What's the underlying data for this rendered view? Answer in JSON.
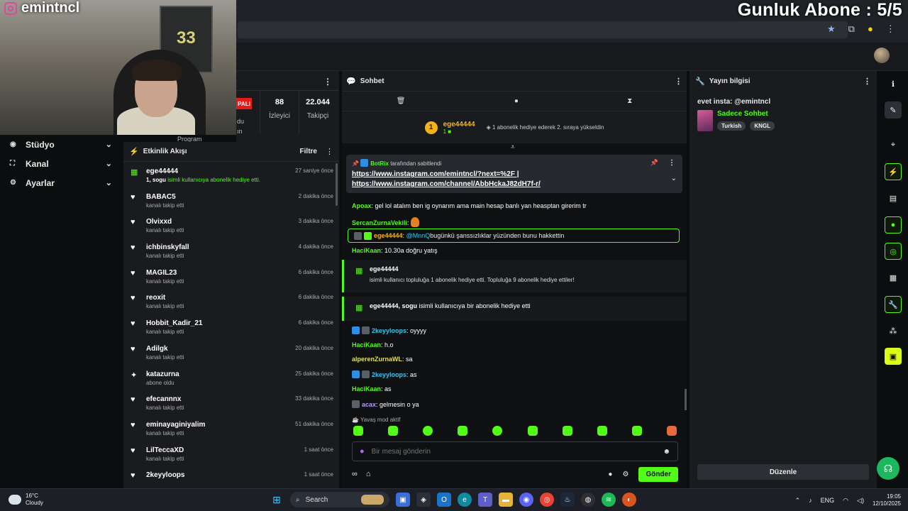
{
  "overlay": {
    "brand": "emintncl",
    "daily_subs": "Gunluk Abone : 5/5"
  },
  "left_nav": {
    "items": [
      {
        "label": "Stüdyo",
        "icon": "studio-icon"
      },
      {
        "label": "Kanal",
        "icon": "channel-icon"
      },
      {
        "label": "Ayarlar",
        "icon": "gear-icon"
      }
    ]
  },
  "stats": {
    "live_badge": "PALI",
    "viewers_value": "88",
    "viewers_label": "İzleyici",
    "followers_value": "22.044",
    "followers_label": "Takipçi",
    "partial_label_a": "du",
    "partial_label_b": "ın",
    "partial_label_c": "Program"
  },
  "feed": {
    "title": "Etkinlik Akışı",
    "filter": "Filtre",
    "items": [
      {
        "name": "ege44444",
        "desc_strong": "1, sogu",
        "desc": " isimli kullanıcıya abonelik hediye etti.",
        "time": "27 saniye önce",
        "icon": "gift-icon"
      },
      {
        "name": "BABAC5",
        "desc": "kanalı takip etti",
        "time": "2 dakika önce",
        "icon": "heart-icon"
      },
      {
        "name": "Olvixxd",
        "desc": "kanalı takip etti",
        "time": "3 dakika önce",
        "icon": "heart-icon"
      },
      {
        "name": "ichbinskyfall",
        "desc": "kanalı takip etti",
        "time": "4 dakika önce",
        "icon": "heart-icon"
      },
      {
        "name": "MAGIL23",
        "desc": "kanalı takip etti",
        "time": "6 dakika önce",
        "icon": "heart-icon"
      },
      {
        "name": "reoxit",
        "desc": "kanalı takip etti",
        "time": "6 dakika önce",
        "icon": "heart-icon"
      },
      {
        "name": "Hobbit_Kadir_21",
        "desc": "kanalı takip etti",
        "time": "6 dakika önce",
        "icon": "heart-icon"
      },
      {
        "name": "Adilgk",
        "desc": "kanalı takip etti",
        "time": "20 dakika önce",
        "icon": "heart-icon"
      },
      {
        "name": "katazurna",
        "desc": "abone oldu",
        "time": "25 dakika önce",
        "icon": "star-icon"
      },
      {
        "name": "efecannnx",
        "desc": "kanalı takip etti",
        "time": "33 dakika önce",
        "icon": "heart-icon"
      },
      {
        "name": "eminayaginiyalim",
        "desc": "kanalı takip etti",
        "time": "51 dakika önce",
        "icon": "heart-icon"
      },
      {
        "name": "LilTeccaXD",
        "desc": "kanalı takip etti",
        "time": "1 saat önce",
        "icon": "heart-icon"
      },
      {
        "name": "2keyyloops",
        "desc": "",
        "time": "1 saat önce",
        "icon": "heart-icon"
      }
    ]
  },
  "chat": {
    "title": "Sohbet",
    "gift_user": "ege44444",
    "gift_rank": "1",
    "gift_sub_count": "1",
    "gift_note": "1 abonelik hediye ederek 2. sıraya yükseldin",
    "pinned_by": "BotRix",
    "pinned_suffix": "tarafından sabitlendi",
    "pinned_link1": "https://www.instagram.com/emintncl/?next=%2F |",
    "pinned_link2": "https://www.instagram.com/channel/AbbHckaJ82dH7f-r/",
    "messages": [
      {
        "user": "Apoax",
        "text": "gel lol atalım ben ig oynarım ama main hesap banlı yan heasptan girerim tr"
      },
      {
        "user": "SercanZurnaVekili",
        "text": ""
      },
      {
        "user": "ege44444",
        "mention": "@MnnQ",
        "text": " bugünkü şanssızlıklar yüzünden bunu hakkettin"
      },
      {
        "user": "HaciKaan",
        "text": "10.30a doğru yatış"
      }
    ],
    "sys1_user": "ege44444",
    "sys1_text": "isimli kullanıcı topluluğa 1 abonelik hediye etti. Topluluğa 9 abonelik hediye ettiler!",
    "sys2_user": "ege44444, sogu",
    "sys2_text": " isimli kullanıcıya bir abonelik hediye etti",
    "messages2": [
      {
        "user": "2keyyloops",
        "text": "oyyyy"
      },
      {
        "user": "HaciKaan",
        "text": "h.o"
      },
      {
        "user": "alperenZurnaWL",
        "text": "sa"
      },
      {
        "user": "2keyyloops",
        "text": "as"
      },
      {
        "user": "HaciKaan",
        "text": "as"
      },
      {
        "user": "acax",
        "text": "gelmesin o ya"
      }
    ],
    "slow_mode": "Yavaş mod aktif",
    "input_placeholder": "Bir mesaj gönderin",
    "send_label": "Gönder"
  },
  "info": {
    "title": "Yayın bilgisi",
    "stream_title": "evet insta: @emintncl",
    "category": "Sadece Sohbet",
    "tags": [
      "Turkish",
      "KNGL"
    ],
    "edit_label": "Düzenle"
  },
  "taskbar": {
    "temp": "16°C",
    "weather": "Cloudy",
    "search": "Search",
    "lang": "ENG",
    "time": "19:05",
    "date": "12/10/2025"
  },
  "colors": {
    "accent": "#53fc18",
    "panel": "#191b1f",
    "background": "#0b0e0f"
  }
}
